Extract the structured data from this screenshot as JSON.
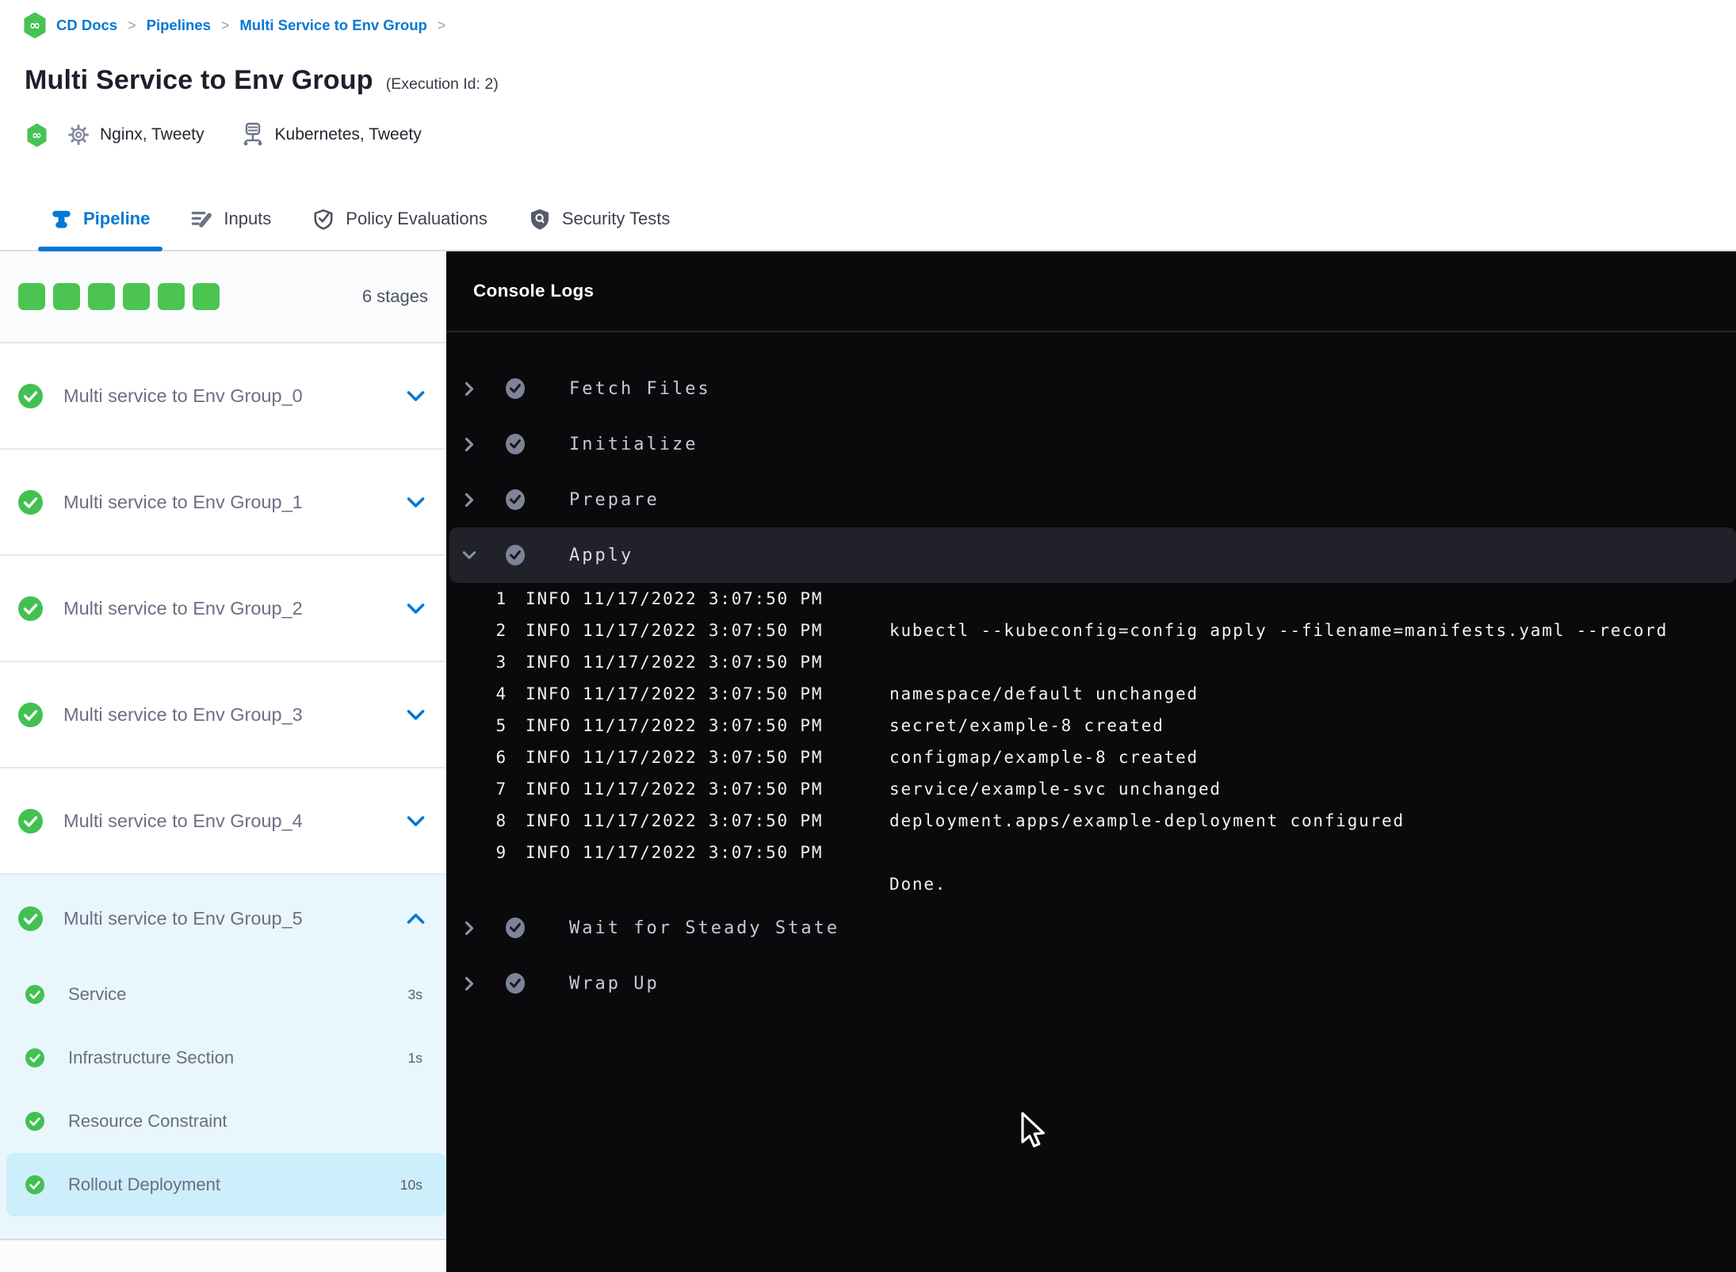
{
  "breadcrumb": {
    "separator": ">",
    "items": [
      "CD Docs",
      "Pipelines",
      "Multi Service to Env Group"
    ]
  },
  "header": {
    "title": "Multi Service to Env Group",
    "execution_id": "(Execution Id: 2)",
    "services_label": "Nginx, Tweety",
    "environments_label": "Kubernetes, Tweety"
  },
  "tabs": [
    {
      "label": "Pipeline",
      "icon": "pipeline-icon",
      "active": true
    },
    {
      "label": "Inputs",
      "icon": "inputs-icon",
      "active": false
    },
    {
      "label": "Policy Evaluations",
      "icon": "policy-evaluations-icon",
      "active": false
    },
    {
      "label": "Security Tests",
      "icon": "security-tests-icon",
      "active": false
    }
  ],
  "sidebar": {
    "stage_count_label": "6 stages",
    "stage_square_count": 6,
    "stages": [
      {
        "label": "Multi service to Env Group_0",
        "status": "success",
        "expanded": false
      },
      {
        "label": "Multi service to Env Group_1",
        "status": "success",
        "expanded": false
      },
      {
        "label": "Multi service to Env Group_2",
        "status": "success",
        "expanded": false
      },
      {
        "label": "Multi service to Env Group_3",
        "status": "success",
        "expanded": false
      },
      {
        "label": "Multi service to Env Group_4",
        "status": "success",
        "expanded": false
      },
      {
        "label": "Multi service to Env Group_5",
        "status": "success",
        "expanded": true
      }
    ],
    "steps": [
      {
        "label": "Service",
        "duration": "3s",
        "status": "success",
        "selected": false
      },
      {
        "label": "Infrastructure Section",
        "duration": "1s",
        "status": "success",
        "selected": false
      },
      {
        "label": "Resource Constraint",
        "duration": "",
        "status": "success",
        "selected": false
      },
      {
        "label": "Rollout Deployment",
        "duration": "10s",
        "status": "success",
        "selected": true
      }
    ]
  },
  "console": {
    "title": "Console Logs",
    "steps_before": [
      {
        "label": "Fetch Files",
        "status": "success",
        "expanded": false
      },
      {
        "label": "Initialize",
        "status": "success",
        "expanded": false
      },
      {
        "label": "Prepare",
        "status": "success",
        "expanded": false
      },
      {
        "label": "Apply",
        "status": "success",
        "expanded": true
      }
    ],
    "logs": [
      {
        "num": "1",
        "level": "INFO",
        "time": "11/17/2022 3:07:50 PM",
        "msg": ""
      },
      {
        "num": "2",
        "level": "INFO",
        "time": "11/17/2022 3:07:50 PM",
        "msg": "kubectl --kubeconfig=config apply --filename=manifests.yaml --record"
      },
      {
        "num": "3",
        "level": "INFO",
        "time": "11/17/2022 3:07:50 PM",
        "msg": ""
      },
      {
        "num": "4",
        "level": "INFO",
        "time": "11/17/2022 3:07:50 PM",
        "msg": "namespace/default unchanged"
      },
      {
        "num": "5",
        "level": "INFO",
        "time": "11/17/2022 3:07:50 PM",
        "msg": "secret/example-8 created"
      },
      {
        "num": "6",
        "level": "INFO",
        "time": "11/17/2022 3:07:50 PM",
        "msg": "configmap/example-8 created"
      },
      {
        "num": "7",
        "level": "INFO",
        "time": "11/17/2022 3:07:50 PM",
        "msg": "service/example-svc unchanged"
      },
      {
        "num": "8",
        "level": "INFO",
        "time": "11/17/2022 3:07:50 PM",
        "msg": "deployment.apps/example-deployment configured"
      },
      {
        "num": "9",
        "level": "INFO",
        "time": "11/17/2022 3:07:50 PM",
        "msg": ""
      }
    ],
    "tail_line": "Done.",
    "steps_after": [
      {
        "label": "Wait for Steady State",
        "status": "success",
        "expanded": false
      },
      {
        "label": "Wrap Up",
        "status": "success",
        "expanded": false
      }
    ]
  },
  "colors": {
    "accent_blue": "#0278d5",
    "success_green": "#4cc452",
    "console_bg": "#0a0a0c",
    "expanded_row_bg": "#212229",
    "selected_step_bg": "#cdeefb",
    "expanded_section_bg": "#e9f7fd"
  }
}
